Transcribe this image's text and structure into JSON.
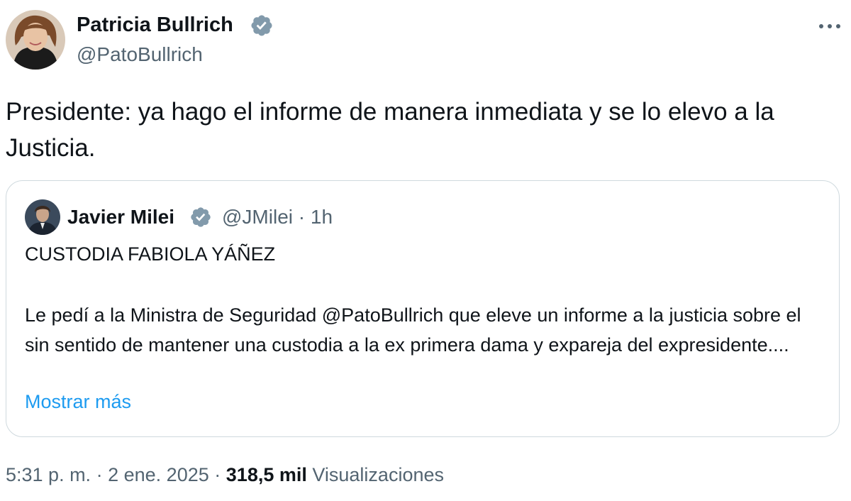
{
  "author": {
    "name": "Patricia Bullrich",
    "handle": "@PatoBullrich",
    "verified_badge_icon": "verified-badge-icon",
    "badge_color": "#829aab"
  },
  "more_options_icon": "more-horizontal-icon",
  "tweet": {
    "text": "Presidente: ya hago el informe de manera inmediata y se lo elevo a la Justicia."
  },
  "quoted_tweet": {
    "name": "Javier Milei",
    "handle": "@JMilei",
    "separator": "·",
    "time_ago": "1h",
    "title": "CUSTODIA FABIOLA YÁÑEZ",
    "body": "Le pedí a la Ministra de Seguridad @PatoBullrich que eleve un informe a la justicia sobre el sin sentido de mantener una custodia a la ex primera dama y expareja del expresidente....",
    "show_more": "Mostrar más"
  },
  "meta": {
    "time": "5:31 p. m.",
    "sep1": "·",
    "date": "2 ene. 2025",
    "sep2": "·",
    "views_count": "318,5 mil",
    "views_label": "Visualizaciones"
  },
  "colors": {
    "text_primary": "#0f1419",
    "text_secondary": "#536471",
    "link": "#1d9bf0",
    "border": "#cfd9de"
  }
}
